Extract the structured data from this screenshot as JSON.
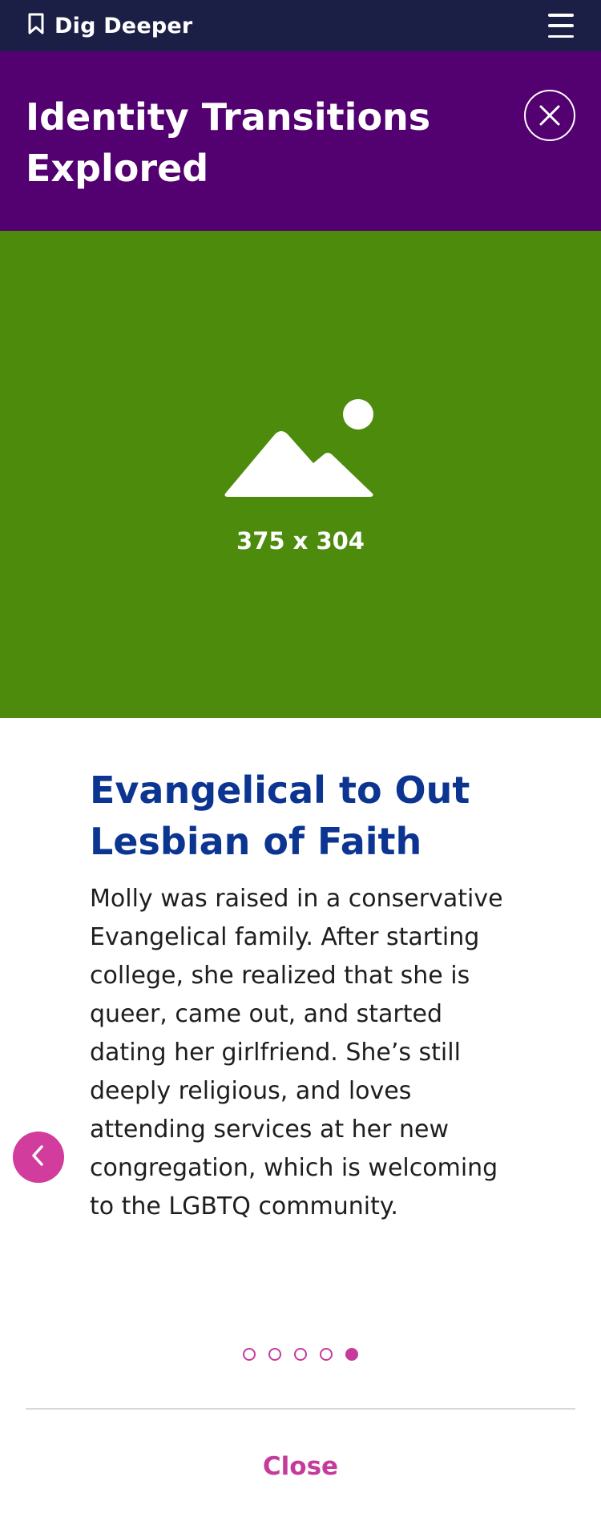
{
  "topbar": {
    "title": "Dig Deeper",
    "bookmark_icon": "bookmark-icon",
    "menu_icon": "hamburger-menu-icon",
    "background": "#1c1f45"
  },
  "header": {
    "title": "Identity Transitions Explored",
    "close_icon": "close-icon",
    "background": "#530070"
  },
  "media": {
    "placeholder_icon": "image-placeholder-icon",
    "label": "375 x 304",
    "background": "#4d8b0d"
  },
  "story": {
    "title": "Evangelical to Out Lesbian of Faith",
    "body": "Molly was raised in a conservative Evangelical family. After starting college, she realized that she is queer, came out, and started dating her girlfriend. She’s still deeply religious, and loves attending services at her new congregation, which is welcoming to the LGBTQ community.",
    "title_color": "#0b3590"
  },
  "carousel": {
    "prev_icon": "chevron-left-icon",
    "slide_count": 5,
    "active_index": 4,
    "accent": "#c53b9b"
  },
  "footer": {
    "close_label": "Close"
  }
}
